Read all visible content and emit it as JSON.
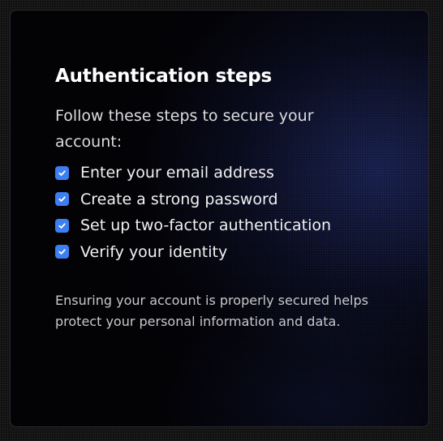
{
  "card": {
    "title": "Authentication steps",
    "intro": "Follow these steps to secure your account:",
    "steps": [
      {
        "label": "Enter your email address",
        "icon": "checkbox-checked-icon",
        "checked": true
      },
      {
        "label": "Create a strong password",
        "icon": "checkbox-checked-icon",
        "checked": true
      },
      {
        "label": "Set up two-factor authentication",
        "icon": "checkbox-checked-icon",
        "checked": true
      },
      {
        "label": "Verify your identity",
        "icon": "checkbox-checked-icon",
        "checked": true
      }
    ],
    "note": "Ensuring your account is properly secured helps protect your personal information and data."
  },
  "colors": {
    "accent": "#3d7ff2",
    "title_text": "#ffffff",
    "body_text": "#dcdce0",
    "note_text": "#c8c8cd"
  }
}
